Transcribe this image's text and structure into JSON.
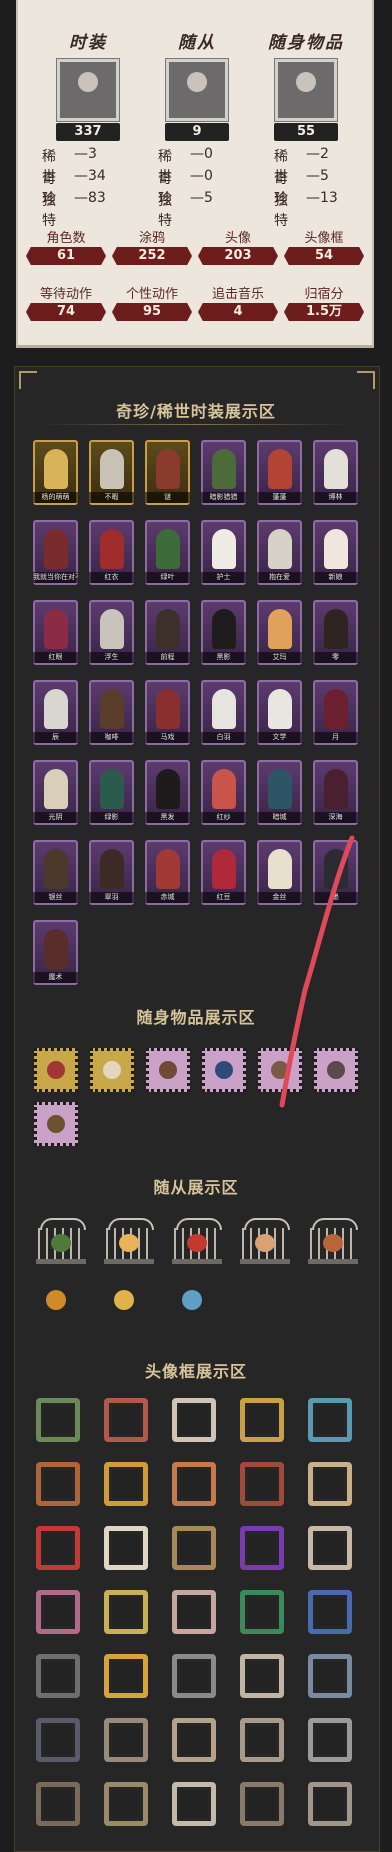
{
  "stats": {
    "categories": [
      {
        "title": "时装",
        "count": "337",
        "rarities": [
          {
            "label": "稀世",
            "value": "3"
          },
          {
            "label": "奇珍",
            "value": "34"
          },
          {
            "label": "独特",
            "value": "83"
          }
        ]
      },
      {
        "title": "随从",
        "count": "9",
        "rarities": [
          {
            "label": "稀世",
            "value": "0"
          },
          {
            "label": "奇珍",
            "value": "0"
          },
          {
            "label": "独特",
            "value": "5"
          }
        ]
      },
      {
        "title": "随身物品",
        "count": "55",
        "rarities": [
          {
            "label": "稀世",
            "value": "2"
          },
          {
            "label": "奇珍",
            "value": "5"
          },
          {
            "label": "独特",
            "value": "13"
          }
        ]
      }
    ],
    "counters": [
      {
        "label": "角色数",
        "value": "61"
      },
      {
        "label": "涂鸦",
        "value": "252"
      },
      {
        "label": "头像",
        "value": "203"
      },
      {
        "label": "头像框",
        "value": "54"
      },
      {
        "label": "等待动作",
        "value": "74"
      },
      {
        "label": "个性动作",
        "value": "95"
      },
      {
        "label": "追击音乐",
        "value": "4"
      },
      {
        "label": "归宿分",
        "value": "1.5万"
      }
    ]
  },
  "sections": {
    "costumes_title": "奇珍/稀世时装展示区",
    "items_title": "随身物品展示区",
    "pets_title": "随从展示区",
    "frames_title": "头像框展示区"
  },
  "costumes": [
    {
      "name": "杨的萌萌",
      "tier": "gold",
      "color": "#d9b35a"
    },
    {
      "name": "不暇",
      "tier": "gold",
      "color": "#c9c2b6"
    },
    {
      "name": "谜",
      "tier": "gold",
      "color": "#8a3b2e"
    },
    {
      "name": "暗影猎猎",
      "tier": "purple",
      "color": "#4d6a3a"
    },
    {
      "name": "蓬蓬",
      "tier": "purple",
      "color": "#b34433"
    },
    {
      "name": "博林",
      "tier": "purple",
      "color": "#e3e0da"
    },
    {
      "name": "我就当你在对不起",
      "tier": "purple",
      "color": "#7a2b2b"
    },
    {
      "name": "红衣",
      "tier": "purple",
      "color": "#a12c2c"
    },
    {
      "name": "绿叶",
      "tier": "purple",
      "color": "#3e6b3a"
    },
    {
      "name": "护士",
      "tier": "purple",
      "color": "#efece5"
    },
    {
      "name": "抱在爱",
      "tier": "purple",
      "color": "#d7d2c7"
    },
    {
      "name": "新娘",
      "tier": "purple",
      "color": "#f0e6de"
    },
    {
      "name": "红眼",
      "tier": "purple",
      "color": "#8b2b45"
    },
    {
      "name": "浮生",
      "tier": "purple",
      "color": "#c8c4bb"
    },
    {
      "name": "前程",
      "tier": "purple",
      "color": "#3d2f2a"
    },
    {
      "name": "黑影",
      "tier": "purple",
      "color": "#1e1c1c"
    },
    {
      "name": "艾玛",
      "tier": "purple",
      "color": "#e0a25a"
    },
    {
      "name": "零",
      "tier": "purple",
      "color": "#2e2422"
    },
    {
      "name": "辰",
      "tier": "purple",
      "color": "#d8d6d1"
    },
    {
      "name": "咖啡",
      "tier": "purple",
      "color": "#5a3d2a"
    },
    {
      "name": "马戏",
      "tier": "purple",
      "color": "#8a2f2f"
    },
    {
      "name": "白羽",
      "tier": "purple",
      "color": "#e6e4de"
    },
    {
      "name": "文学",
      "tier": "purple",
      "color": "#e8e6e1"
    },
    {
      "name": "月",
      "tier": "purple",
      "color": "#6b1f2f"
    },
    {
      "name": "光阴",
      "tier": "purple",
      "color": "#d9cfb8"
    },
    {
      "name": "绿影",
      "tier": "purple",
      "color": "#2b5b4d"
    },
    {
      "name": "黑发",
      "tier": "purple",
      "color": "#1c1a1a"
    },
    {
      "name": "红纱",
      "tier": "purple",
      "color": "#c9554a"
    },
    {
      "name": "暗城",
      "tier": "purple",
      "color": "#2d5566"
    },
    {
      "name": "深海",
      "tier": "purple",
      "color": "#4a1f2f"
    },
    {
      "name": "银丝",
      "tier": "purple",
      "color": "#4b3a2c"
    },
    {
      "name": "翠羽",
      "tier": "purple",
      "color": "#3c2b24"
    },
    {
      "name": "赤城",
      "tier": "purple",
      "color": "#a13a35"
    },
    {
      "name": "红豆",
      "tier": "purple",
      "color": "#b0293a"
    },
    {
      "name": "金丝",
      "tier": "purple",
      "color": "#e8e0cd"
    },
    {
      "name": "墨",
      "tier": "purple",
      "color": "#2b2b33"
    },
    {
      "name": "魔术",
      "tier": "purple",
      "color": "#5a2d2d"
    }
  ],
  "items": [
    {
      "name": "gold-item-1",
      "tier": "gold",
      "color": "#a13636"
    },
    {
      "name": "gold-item-2",
      "tier": "gold",
      "color": "#e3d7c2"
    },
    {
      "name": "pink-item-1",
      "tier": "pink",
      "color": "#6f4a34"
    },
    {
      "name": "pink-item-2",
      "tier": "pink",
      "color": "#2f4a7a"
    },
    {
      "name": "pink-item-3",
      "tier": "pink",
      "color": "#7a5a44"
    },
    {
      "name": "pink-item-4",
      "tier": "pink",
      "color": "#5c4a4a"
    },
    {
      "name": "pink-item-5",
      "tier": "pink",
      "color": "#6b5230"
    }
  ],
  "pets": [
    {
      "color": "#4f7a3a"
    },
    {
      "color": "#e8b45a"
    },
    {
      "color": "#c23a2e"
    },
    {
      "color": "#d8a274"
    },
    {
      "color": "#b8653a"
    }
  ],
  "pets_small": [
    {
      "color": "#d08a2a"
    },
    {
      "color": "#e0b24a"
    },
    {
      "color": "#5ea0c8"
    }
  ],
  "frames": [
    "#6a8a5a",
    "#b25a4a",
    "#cfc4b6",
    "#c9a046",
    "#5a9ab0",
    "#b0643a",
    "#d19a3a",
    "#c47a4a",
    "#a04a3a",
    "#c9b089",
    "#c23a35",
    "#e0d6c4",
    "#a88a5a",
    "#7a3ab0",
    "#c8b8a6",
    "#b06a8a",
    "#c9b054",
    "#c7a6a0",
    "#3a8a5a",
    "#4a6ab0",
    "#6e6e6e",
    "#d6a43a",
    "#8a8a8a",
    "#c1b6a6",
    "#7a8aa0",
    "#5a5a6a",
    "#9a8a7a",
    "#b4a28a",
    "#a89a8a",
    "#9a9a9a",
    "#7a6a5a",
    "#9a8a6a",
    "#c4baac",
    "#8a7a6a",
    "#a0968a"
  ]
}
